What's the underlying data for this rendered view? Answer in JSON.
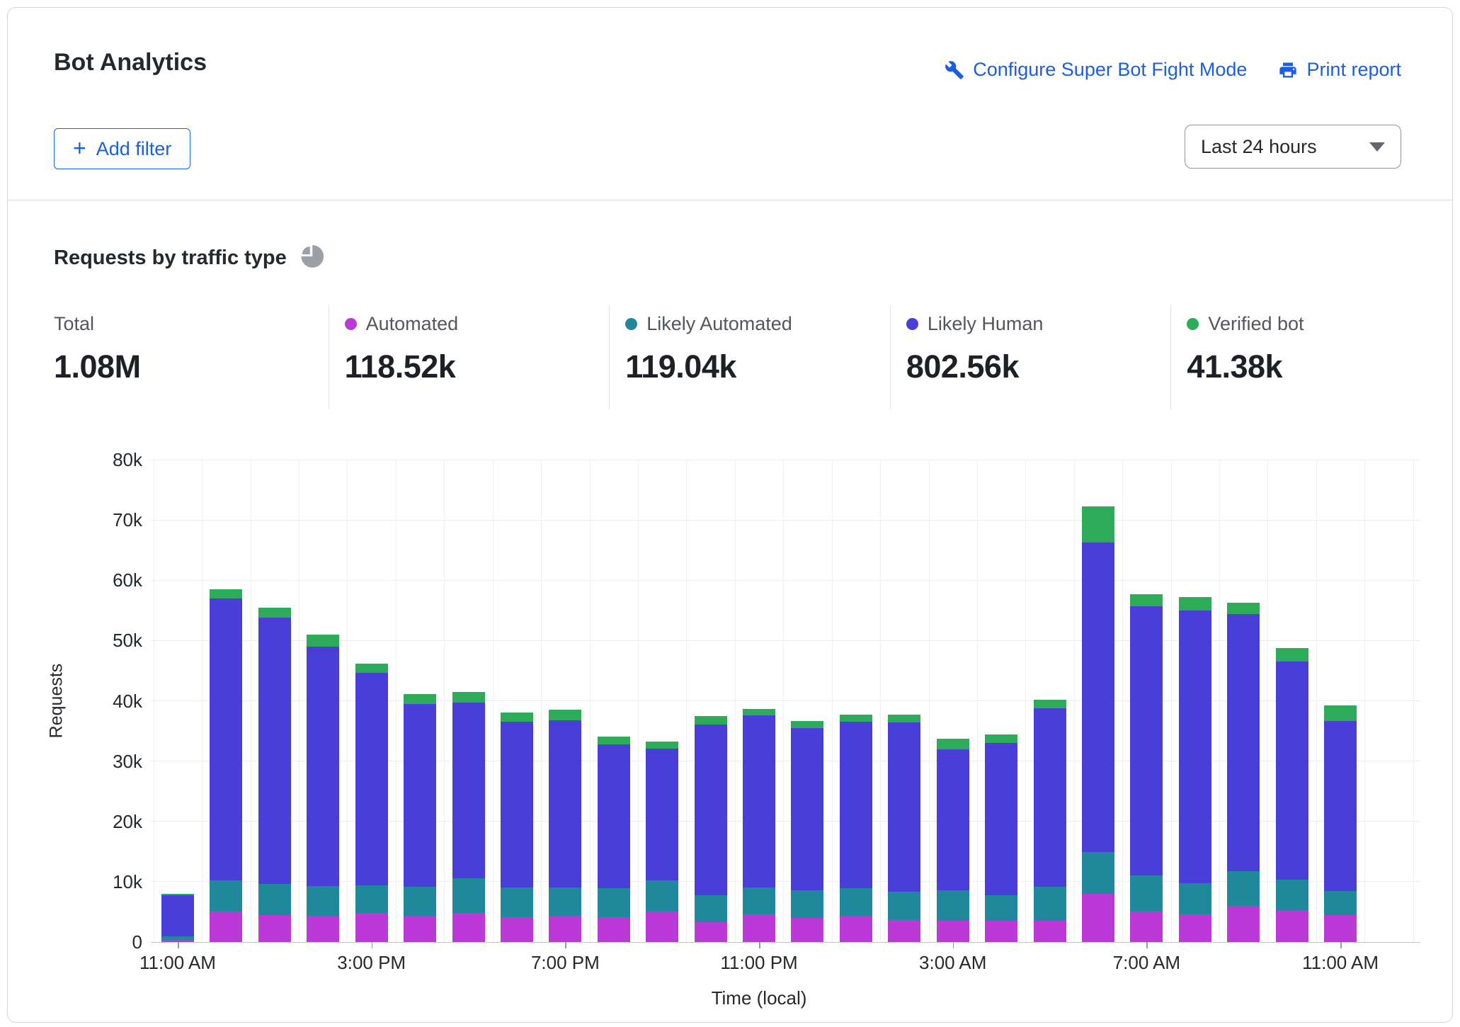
{
  "header": {
    "title": "Bot Analytics",
    "configure_link": "Configure Super Bot Fight Mode",
    "print_link": "Print report",
    "add_filter_label": "Add filter",
    "plus_glyph": "+",
    "time_range_value": "Last 24 hours"
  },
  "section": {
    "title": "Requests by traffic type",
    "stats": [
      {
        "label": "Total",
        "value": "1.08M",
        "color": null
      },
      {
        "label": "Automated",
        "value": "118.52k",
        "color": "#bb39d7"
      },
      {
        "label": "Likely Automated",
        "value": "119.04k",
        "color": "#20889b"
      },
      {
        "label": "Likely Human",
        "value": "802.56k",
        "color": "#4a3ed8"
      },
      {
        "label": "Verified bot",
        "value": "41.38k",
        "color": "#2dab58"
      }
    ]
  },
  "chart_data": {
    "type": "bar",
    "stacked": true,
    "title": "Requests by traffic type",
    "xlabel": "Time (local)",
    "ylabel": "Requests",
    "values_unit": "thousands of requests",
    "ylim": [
      0,
      80
    ],
    "yticks": [
      0,
      10,
      20,
      30,
      40,
      50,
      60,
      70,
      80
    ],
    "ytick_labels": [
      "0",
      "10k",
      "20k",
      "30k",
      "40k",
      "50k",
      "60k",
      "70k",
      "80k"
    ],
    "grid": true,
    "legend_position": "top-stats-row",
    "categories": [
      "11:00 AM",
      "12:00 PM",
      "1:00 PM",
      "2:00 PM",
      "3:00 PM",
      "4:00 PM",
      "5:00 PM",
      "6:00 PM",
      "7:00 PM",
      "8:00 PM",
      "9:00 PM",
      "10:00 PM",
      "11:00 PM",
      "12:00 AM",
      "1:00 AM",
      "2:00 AM",
      "3:00 AM",
      "4:00 AM",
      "5:00 AM",
      "6:00 AM",
      "7:00 AM",
      "8:00 AM",
      "9:00 AM",
      "10:00 AM",
      "11:00 AM"
    ],
    "xtick_indices": [
      0,
      4,
      8,
      12,
      16,
      20,
      24
    ],
    "xtick_labels": [
      "11:00 AM",
      "3:00 PM",
      "7:00 PM",
      "11:00 PM",
      "3:00 AM",
      "7:00 AM",
      "11:00 AM"
    ],
    "series": [
      {
        "name": "Automated",
        "color": "#bb39d7",
        "values": [
          0.3,
          5.0,
          4.5,
          4.4,
          4.8,
          4.3,
          4.8,
          4.1,
          4.3,
          4.1,
          5.1,
          3.3,
          4.6,
          4.0,
          4.3,
          3.7,
          3.5,
          3.5,
          3.5,
          8.0,
          5.1,
          4.6,
          6.0,
          5.3,
          4.5
        ]
      },
      {
        "name": "Likely Automated",
        "color": "#20889b",
        "values": [
          0.6,
          5.2,
          5.1,
          4.9,
          4.6,
          4.9,
          5.8,
          4.9,
          4.7,
          4.8,
          5.1,
          4.4,
          4.4,
          4.6,
          4.6,
          4.6,
          5.1,
          4.2,
          5.7,
          6.9,
          5.9,
          5.2,
          5.7,
          5.0,
          4.0
        ]
      },
      {
        "name": "Likely Human",
        "color": "#4a3ed8",
        "values": [
          6.8,
          46.8,
          44.2,
          39.7,
          35.3,
          30.3,
          29.1,
          27.5,
          27.8,
          23.9,
          21.9,
          28.4,
          28.6,
          26.9,
          27.6,
          28.1,
          23.3,
          25.3,
          29.6,
          51.3,
          44.7,
          45.2,
          42.7,
          36.2,
          28.1
        ]
      },
      {
        "name": "Verified bot",
        "color": "#2dab58",
        "values": [
          0.3,
          1.5,
          1.7,
          2.0,
          1.5,
          1.6,
          1.8,
          1.6,
          1.7,
          1.3,
          1.1,
          1.4,
          1.1,
          1.2,
          1.2,
          1.3,
          1.8,
          1.4,
          1.4,
          6.0,
          2.0,
          2.2,
          1.9,
          2.2,
          2.6
        ]
      }
    ]
  },
  "colors": {
    "link_blue": "#1b5fe0",
    "icon_gray": "#9aa0a6",
    "automated": "#bb39d7",
    "likely_automated": "#20889b",
    "likely_human": "#4a3ed8",
    "verified_bot": "#2dab58"
  }
}
